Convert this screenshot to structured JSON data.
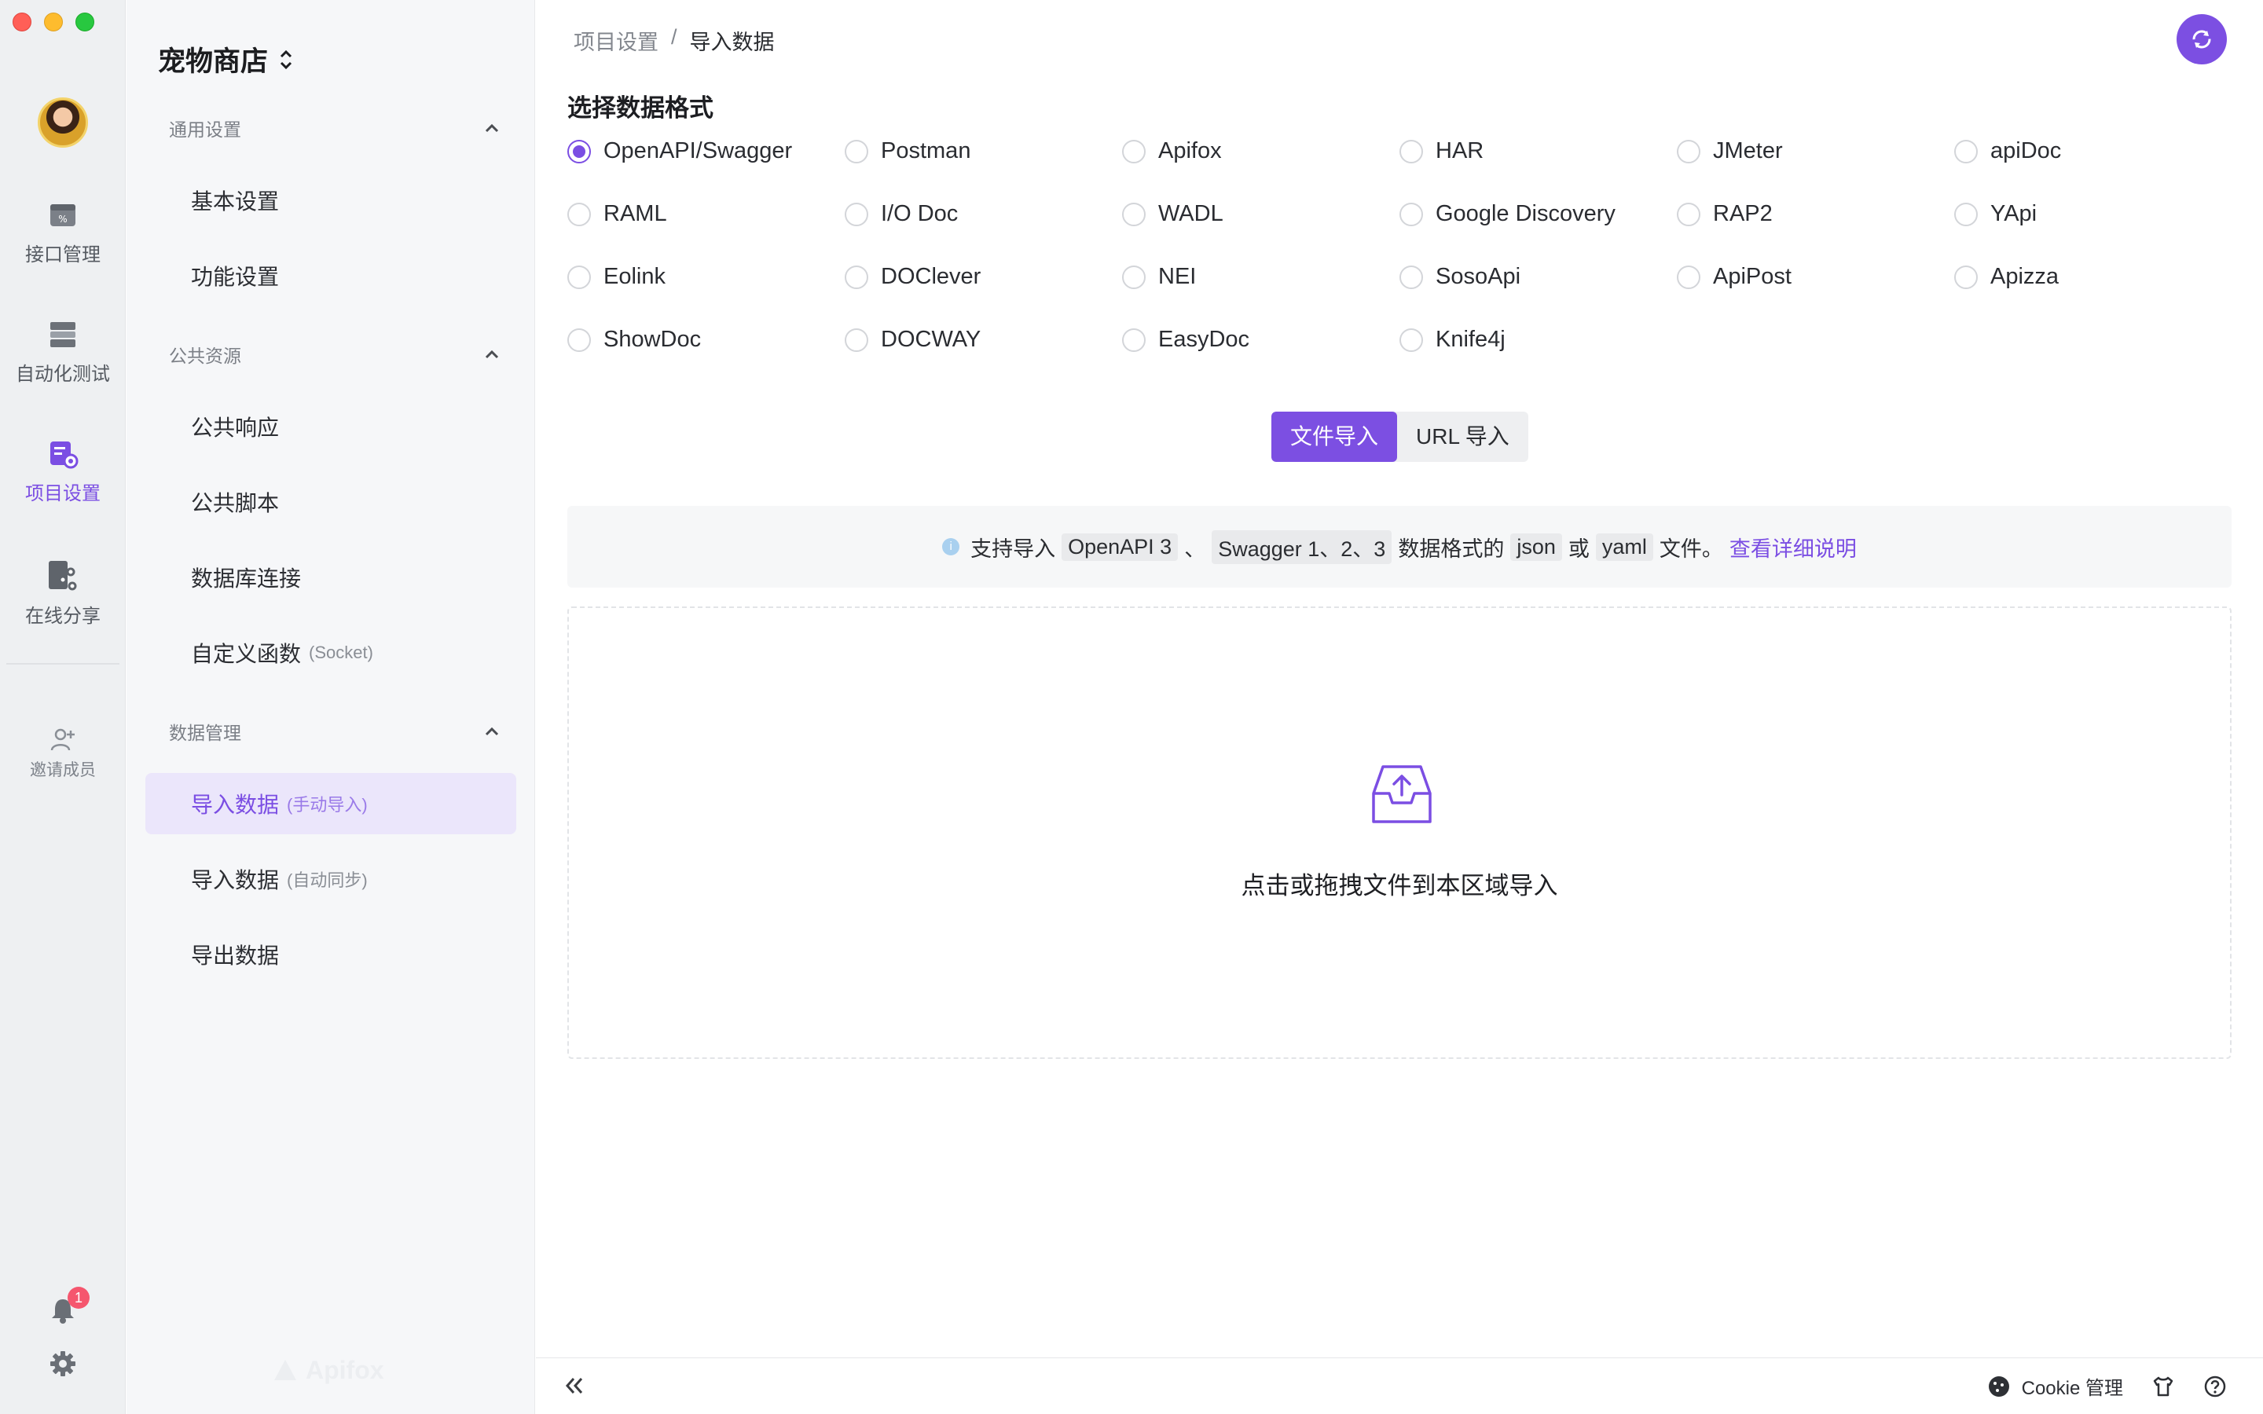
{
  "rail": {
    "items": [
      {
        "label": "接口管理",
        "icon": "api-icon"
      },
      {
        "label": "自动化测试",
        "icon": "test-icon"
      },
      {
        "label": "项目设置",
        "icon": "project-settings-icon"
      },
      {
        "label": "在线分享",
        "icon": "share-icon"
      }
    ],
    "invite_label": "邀请成员",
    "notification_count": "1"
  },
  "sidebar": {
    "project_name": "宠物商店",
    "groups": [
      {
        "label": "通用设置",
        "items": [
          {
            "label": "基本设置"
          },
          {
            "label": "功能设置"
          }
        ]
      },
      {
        "label": "公共资源",
        "items": [
          {
            "label": "公共响应"
          },
          {
            "label": "公共脚本"
          },
          {
            "label": "数据库连接"
          },
          {
            "label": "自定义函数",
            "sub": "(Socket)"
          }
        ]
      },
      {
        "label": "数据管理",
        "items": [
          {
            "label": "导入数据",
            "sub": "(手动导入)",
            "active": true
          },
          {
            "label": "导入数据",
            "sub": "(自动同步)"
          },
          {
            "label": "导出数据"
          }
        ]
      }
    ],
    "watermark": "Apifox"
  },
  "breadcrumb": {
    "parent": "项目设置",
    "separator": "/",
    "current": "导入数据"
  },
  "format_section": {
    "title": "选择数据格式",
    "selected": "OpenAPI/Swagger",
    "options": [
      "OpenAPI/Swagger",
      "Postman",
      "Apifox",
      "HAR",
      "JMeter",
      "apiDoc",
      "RAML",
      "I/O Doc",
      "WADL",
      "Google Discovery",
      "RAP2",
      "YApi",
      "Eolink",
      "DOClever",
      "NEI",
      "SosoApi",
      "ApiPost",
      "Apizza",
      "ShowDoc",
      "DOCWAY",
      "EasyDoc",
      "Knife4j"
    ]
  },
  "import_tabs": {
    "file": "文件导入",
    "url": "URL 导入",
    "active": "file"
  },
  "info": {
    "prefix": "支持导入",
    "code1": "OpenAPI 3",
    "sep1": "、",
    "code2": "Swagger 1、2、3",
    "mid": "数据格式的",
    "code3": "json",
    "or": "或",
    "code4": "yaml",
    "suffix": "文件。",
    "link": "查看详细说明"
  },
  "dropzone": {
    "text": "点击或拖拽文件到本区域导入"
  },
  "footer": {
    "cookie_label": "Cookie 管理"
  },
  "colors": {
    "accent": "#7b4ee3",
    "rail_bg": "#eef0f2",
    "sidebar_bg": "#f6f7f9",
    "active_bg": "#ebe6fb"
  }
}
